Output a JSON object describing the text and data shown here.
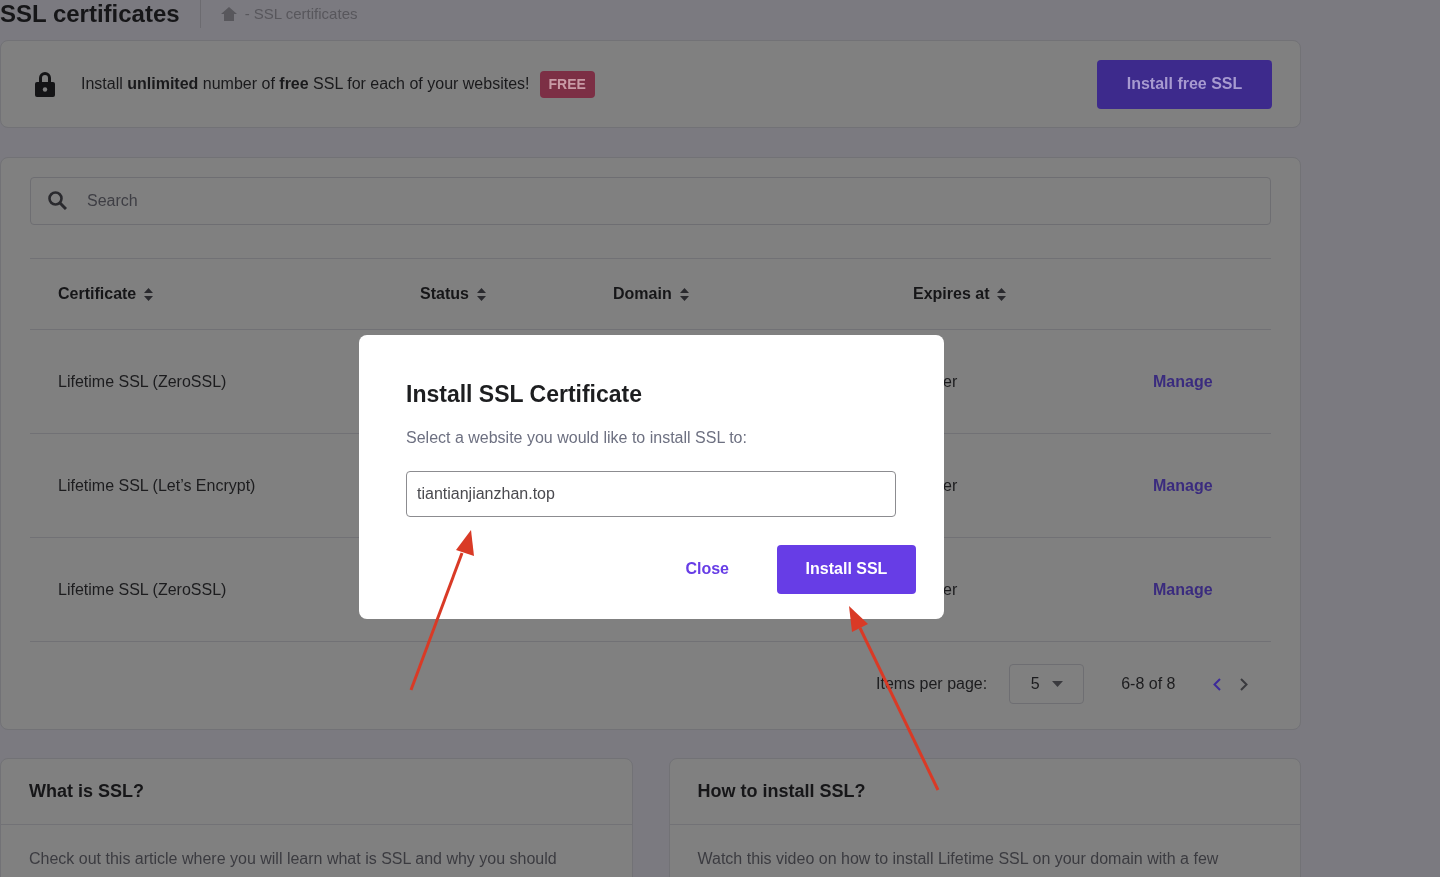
{
  "header": {
    "title": "SSL certificates",
    "breadcrumb": "- SSL certificates"
  },
  "banner": {
    "text": "Install **unlimited** number of **free** SSL for each of your websites!",
    "badge": "FREE",
    "button": "Install free SSL"
  },
  "search": {
    "placeholder": "Search"
  },
  "table": {
    "columns": [
      {
        "label": "Certificate"
      },
      {
        "label": "Status"
      },
      {
        "label": "Domain"
      },
      {
        "label": "Expires at"
      }
    ],
    "rows": [
      {
        "certificate": "Lifetime SSL (ZeroSSL)",
        "expires": "er",
        "action": "Manage"
      },
      {
        "certificate": "Lifetime SSL (Let’s Encrypt)",
        "expires": "er",
        "action": "Manage"
      },
      {
        "certificate": "Lifetime SSL (ZeroSSL)",
        "expires": "er",
        "action": "Manage"
      }
    ]
  },
  "pagination": {
    "label": "Items per page:",
    "per_page": "5",
    "range": "6-8 of 8",
    "prev_enabled": true,
    "next_enabled": false
  },
  "info_cards": [
    {
      "title": "What is SSL?",
      "text": "Check out this article where you will learn what is SSL and why you should"
    },
    {
      "title": "How to install SSL?",
      "text": "Watch this video on how to install Lifetime SSL on your domain with a few"
    }
  ],
  "dialog": {
    "title": "Install SSL Certificate",
    "prompt": "Select a website you would like to install SSL to:",
    "value": "tiantianjianzhan.top",
    "buttons": [
      {
        "label": "Close",
        "kind": "text"
      },
      {
        "label": "Install SSL",
        "kind": "primary"
      }
    ]
  }
}
